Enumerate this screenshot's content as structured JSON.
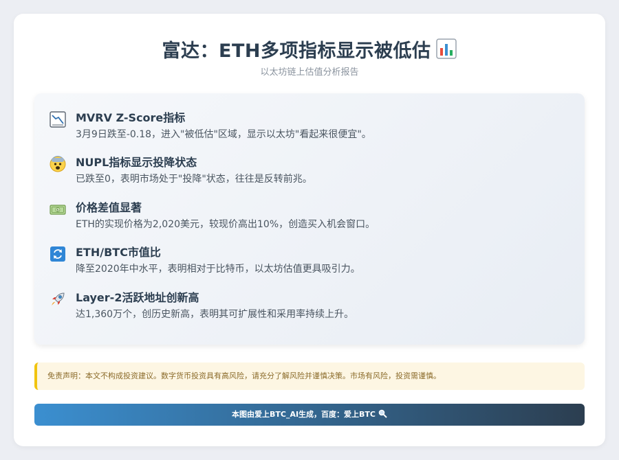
{
  "header": {
    "title": "富达：ETH多项指标显示被低估",
    "title_icon": "bar-chart-icon",
    "subtitle": "以太坊链上估值分析报告"
  },
  "points": [
    {
      "icon": "chart-decreasing-icon",
      "title": "MVRV Z-Score指标",
      "desc": "3月9日跌至-0.18，进入\"被低估\"区域，显示以太坊\"看起来很便宜\"。"
    },
    {
      "icon": "fearful-face-icon",
      "title": "NUPL指标显示投降状态",
      "desc": "已跌至0，表明市场处于\"投降\"状态，往往是反转前兆。"
    },
    {
      "icon": "dollar-banknote-icon",
      "title": "价格差值显著",
      "desc": "ETH的实现价格为2,020美元，较现价高出10%，创造买入机会窗口。"
    },
    {
      "icon": "refresh-arrows-icon",
      "title": "ETH/BTC市值比",
      "desc": "降至2020年中水平，表明相对于比特币，以太坊估值更具吸引力。"
    },
    {
      "icon": "rocket-icon",
      "title": "Layer-2活跃地址创新高",
      "desc": "达1,360万个，创历史新高，表明其可扩展性和采用率持续上升。"
    }
  ],
  "disclaimer": "免责声明：本文不构成投资建议。数字货币投资具有高风险，请充分了解风险并谨慎决策。市场有风险，投资需谨慎。",
  "footer": {
    "text": "本图由爱上BTC_AI生成，百度：爱上BTC",
    "icon": "magnifier-icon"
  },
  "colors": {
    "title": "#2c3e50",
    "disclaimer_border": "#f1c40f",
    "footer_start": "#3b8fd0",
    "footer_end": "#2c3e50"
  }
}
